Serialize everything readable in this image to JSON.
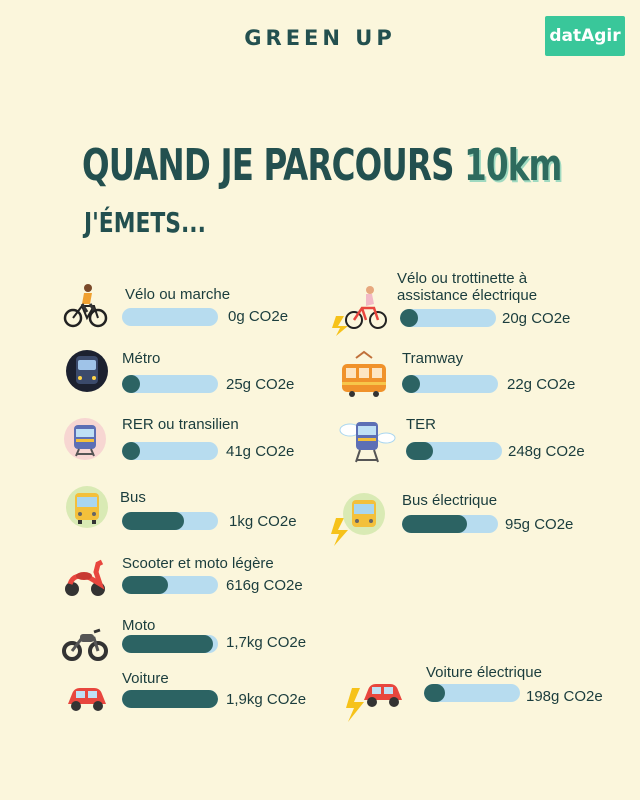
{
  "header": {
    "brand": "GREEN UP",
    "logo": "datAgir"
  },
  "title": {
    "line1_prefix": "QUAND JE PARCOURS ",
    "line1_highlight": "10km",
    "line2": "J'ÉMETS..."
  },
  "colors": {
    "background": "#fbf6dc",
    "bar_track": "#b7dcef",
    "bar_fill": "#2c6363",
    "title": "#23504f",
    "logo_bg": "#39c79a"
  },
  "items": [
    {
      "id": "velo",
      "label": "Vélo ou marche",
      "value": "0g CO2e",
      "level": 0.0,
      "icon": "bicycle-icon"
    },
    {
      "id": "metro",
      "label": "Métro",
      "value": "25g CO2e",
      "level": 0.12,
      "icon": "metro-icon"
    },
    {
      "id": "rer",
      "label": "RER ou transilien",
      "value": "41g CO2e",
      "level": 0.12,
      "icon": "train-icon"
    },
    {
      "id": "bus",
      "label": "Bus",
      "value": "1kg CO2e",
      "level": 0.65,
      "icon": "bus-icon"
    },
    {
      "id": "scooter",
      "label": "Scooter et moto légère",
      "value": "616g CO2e",
      "level": 0.48,
      "icon": "scooter-icon"
    },
    {
      "id": "moto",
      "label": "Moto",
      "value": "1,7kg CO2e",
      "level": 0.95,
      "icon": "motorcycle-icon"
    },
    {
      "id": "voiture",
      "label": "Voiture",
      "value": "1,9kg CO2e",
      "level": 1.0,
      "icon": "car-icon"
    },
    {
      "id": "velo-elec",
      "label": "Vélo ou trottinette à assistance électrique",
      "label_line1": "Vélo ou trottinette à",
      "label_line2": "assistance électrique",
      "value": "20g CO2e",
      "level": 0.12,
      "icon": "electric-bike-icon"
    },
    {
      "id": "tramway",
      "label": "Tramway",
      "value": "22g CO2e",
      "level": 0.12,
      "icon": "tramway-icon"
    },
    {
      "id": "ter",
      "label": "TER",
      "value": "248g CO2e",
      "level": 0.28,
      "icon": "ter-train-icon"
    },
    {
      "id": "bus-elec",
      "label": "Bus électrique",
      "value": "95g CO2e",
      "level": 0.68,
      "icon": "electric-bus-icon"
    },
    {
      "id": "voiture-elec",
      "label": "Voiture électrique",
      "value": "198g CO2e",
      "level": 0.22,
      "icon": "electric-car-icon"
    }
  ]
}
